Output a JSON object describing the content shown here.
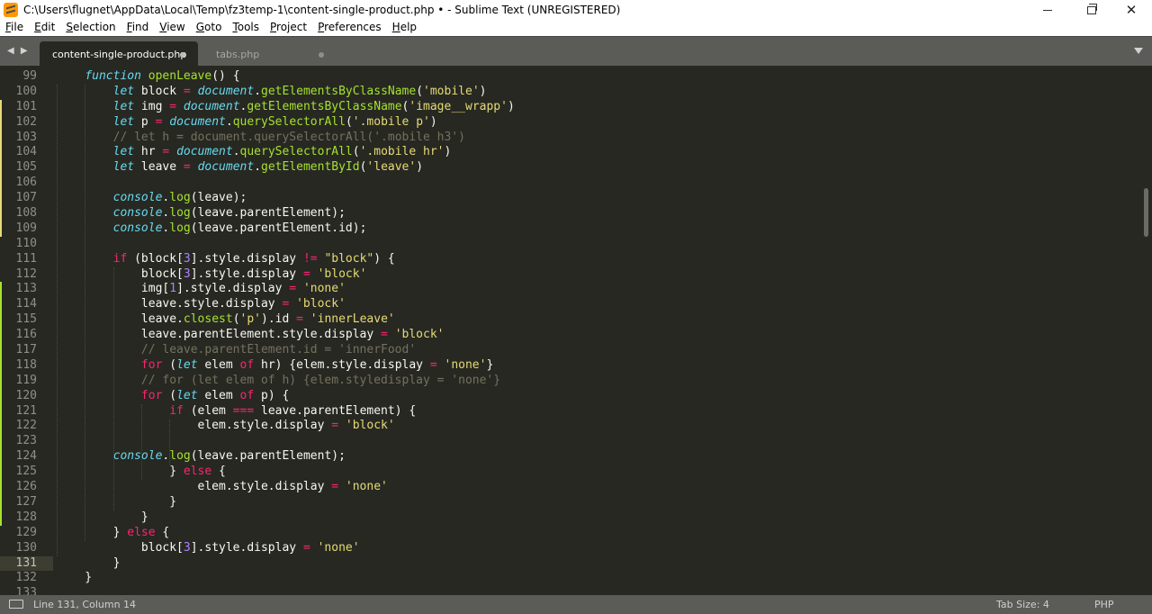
{
  "window": {
    "title": "C:\\Users\\flugnet\\AppData\\Local\\Temp\\fz3temp-1\\content-single-product.php • - Sublime Text (UNREGISTERED)",
    "min_label": "",
    "close_label": "✕"
  },
  "menu": [
    "File",
    "Edit",
    "Selection",
    "Find",
    "View",
    "Goto",
    "Tools",
    "Project",
    "Preferences",
    "Help"
  ],
  "tabs": [
    {
      "label": "content-single-product.php",
      "active": true,
      "modified": true
    },
    {
      "label": "tabs.php",
      "active": false,
      "modified": true
    }
  ],
  "tab_nav": "◀ ▶",
  "editor": {
    "lines": [
      {
        "n": "99",
        "mark": "",
        "code": [
          [
            "    ",
            ""
          ],
          [
            "function",
            "st"
          ],
          [
            " ",
            ""
          ],
          [
            "openLeave",
            "fn"
          ],
          [
            "() {",
            ""
          ]
        ]
      },
      {
        "n": "100",
        "mark": "",
        "code": [
          [
            "        ",
            ""
          ],
          [
            "let",
            "st"
          ],
          [
            " block ",
            ""
          ],
          [
            "=",
            "kw"
          ],
          [
            " ",
            ""
          ],
          [
            "document",
            "sp"
          ],
          [
            ".",
            ""
          ],
          [
            "getElementsByClassName",
            "fn"
          ],
          [
            "(",
            ""
          ],
          [
            "'mobile'",
            "str"
          ],
          [
            ")",
            ""
          ]
        ]
      },
      {
        "n": "101",
        "mark": "mod",
        "code": [
          [
            "        ",
            ""
          ],
          [
            "let",
            "st"
          ],
          [
            " img ",
            ""
          ],
          [
            "=",
            "kw"
          ],
          [
            " ",
            ""
          ],
          [
            "document",
            "sp"
          ],
          [
            ".",
            ""
          ],
          [
            "getElementsByClassName",
            "fn"
          ],
          [
            "(",
            ""
          ],
          [
            "'image__wrapp'",
            "str"
          ],
          [
            ")",
            ""
          ]
        ]
      },
      {
        "n": "102",
        "mark": "mod",
        "code": [
          [
            "        ",
            ""
          ],
          [
            "let",
            "st"
          ],
          [
            " p ",
            ""
          ],
          [
            "=",
            "kw"
          ],
          [
            " ",
            ""
          ],
          [
            "document",
            "sp"
          ],
          [
            ".",
            ""
          ],
          [
            "querySelectorAll",
            "fn"
          ],
          [
            "(",
            ""
          ],
          [
            "'.mobile p'",
            "str"
          ],
          [
            ")",
            ""
          ]
        ]
      },
      {
        "n": "103",
        "mark": "mod",
        "code": [
          [
            "        ",
            ""
          ],
          [
            "// let h = document.querySelectorAll('.mobile h3')",
            "cm"
          ]
        ]
      },
      {
        "n": "104",
        "mark": "mod",
        "code": [
          [
            "        ",
            ""
          ],
          [
            "let",
            "st"
          ],
          [
            " hr ",
            ""
          ],
          [
            "=",
            "kw"
          ],
          [
            " ",
            ""
          ],
          [
            "document",
            "sp"
          ],
          [
            ".",
            ""
          ],
          [
            "querySelectorAll",
            "fn"
          ],
          [
            "(",
            ""
          ],
          [
            "'.mobile hr'",
            "str"
          ],
          [
            ")",
            ""
          ]
        ]
      },
      {
        "n": "105",
        "mark": "mod",
        "code": [
          [
            "        ",
            ""
          ],
          [
            "let",
            "st"
          ],
          [
            " leave ",
            ""
          ],
          [
            "=",
            "kw"
          ],
          [
            " ",
            ""
          ],
          [
            "document",
            "sp"
          ],
          [
            ".",
            ""
          ],
          [
            "getElementById",
            "fn"
          ],
          [
            "(",
            ""
          ],
          [
            "'leave'",
            "str"
          ],
          [
            ")",
            ""
          ]
        ]
      },
      {
        "n": "106",
        "mark": "mod",
        "code": []
      },
      {
        "n": "107",
        "mark": "mod",
        "code": [
          [
            "        ",
            ""
          ],
          [
            "console",
            "sp"
          ],
          [
            ".",
            ""
          ],
          [
            "log",
            "fn"
          ],
          [
            "(leave);",
            ""
          ]
        ]
      },
      {
        "n": "108",
        "mark": "mod",
        "code": [
          [
            "        ",
            ""
          ],
          [
            "console",
            "sp"
          ],
          [
            ".",
            ""
          ],
          [
            "log",
            "fn"
          ],
          [
            "(leave.parentElement);",
            ""
          ]
        ]
      },
      {
        "n": "109",
        "mark": "mod",
        "code": [
          [
            "        ",
            ""
          ],
          [
            "console",
            "sp"
          ],
          [
            ".",
            ""
          ],
          [
            "log",
            "fn"
          ],
          [
            "(leave.parentElement.id);",
            ""
          ]
        ]
      },
      {
        "n": "110",
        "mark": "",
        "code": []
      },
      {
        "n": "111",
        "mark": "",
        "code": [
          [
            "        ",
            ""
          ],
          [
            "if",
            "kw"
          ],
          [
            " (block[",
            ""
          ],
          [
            "3",
            "num"
          ],
          [
            "].style.display ",
            ""
          ],
          [
            "!=",
            "kw"
          ],
          [
            " ",
            ""
          ],
          [
            "\"block\"",
            "str"
          ],
          [
            ") {",
            ""
          ]
        ]
      },
      {
        "n": "112",
        "mark": "",
        "code": [
          [
            "            block[",
            ""
          ],
          [
            "3",
            "num"
          ],
          [
            "].style.display ",
            ""
          ],
          [
            "=",
            "kw"
          ],
          [
            " ",
            ""
          ],
          [
            "'block'",
            "str"
          ]
        ]
      },
      {
        "n": "113",
        "mark": "add",
        "code": [
          [
            "            img[",
            ""
          ],
          [
            "1",
            "num"
          ],
          [
            "].style.display ",
            ""
          ],
          [
            "=",
            "kw"
          ],
          [
            " ",
            ""
          ],
          [
            "'none'",
            "str"
          ]
        ]
      },
      {
        "n": "114",
        "mark": "add",
        "code": [
          [
            "            leave.style.display ",
            ""
          ],
          [
            "=",
            "kw"
          ],
          [
            " ",
            ""
          ],
          [
            "'block'",
            "str"
          ]
        ]
      },
      {
        "n": "115",
        "mark": "add",
        "code": [
          [
            "            leave.",
            ""
          ],
          [
            "closest",
            "fn"
          ],
          [
            "(",
            ""
          ],
          [
            "'p'",
            "str"
          ],
          [
            ").id ",
            ""
          ],
          [
            "=",
            "kw"
          ],
          [
            " ",
            ""
          ],
          [
            "'innerLeave'",
            "str"
          ]
        ]
      },
      {
        "n": "116",
        "mark": "add",
        "code": [
          [
            "            leave.parentElement.style.display ",
            ""
          ],
          [
            "=",
            "kw"
          ],
          [
            " ",
            ""
          ],
          [
            "'block'",
            "str"
          ]
        ]
      },
      {
        "n": "117",
        "mark": "add",
        "code": [
          [
            "            ",
            ""
          ],
          [
            "// leave.parentElement.id = 'innerFood'",
            "cm"
          ]
        ]
      },
      {
        "n": "118",
        "mark": "add",
        "code": [
          [
            "            ",
            ""
          ],
          [
            "for",
            "kw"
          ],
          [
            " (",
            ""
          ],
          [
            "let",
            "st"
          ],
          [
            " elem ",
            ""
          ],
          [
            "of",
            "kw"
          ],
          [
            " hr) {elem.style.display ",
            ""
          ],
          [
            "=",
            "kw"
          ],
          [
            " ",
            ""
          ],
          [
            "'none'",
            "str"
          ],
          [
            "}",
            ""
          ]
        ]
      },
      {
        "n": "119",
        "mark": "add",
        "code": [
          [
            "            ",
            ""
          ],
          [
            "// for (let elem of h) {elem.styledisplay = 'none'}",
            "cm"
          ]
        ]
      },
      {
        "n": "120",
        "mark": "add",
        "code": [
          [
            "            ",
            ""
          ],
          [
            "for",
            "kw"
          ],
          [
            " (",
            ""
          ],
          [
            "let",
            "st"
          ],
          [
            " elem ",
            ""
          ],
          [
            "of",
            "kw"
          ],
          [
            " p) {",
            ""
          ]
        ]
      },
      {
        "n": "121",
        "mark": "add",
        "code": [
          [
            "                ",
            ""
          ],
          [
            "if",
            "kw"
          ],
          [
            " (elem ",
            ""
          ],
          [
            "===",
            "kw"
          ],
          [
            " leave.parentElement) {",
            ""
          ]
        ]
      },
      {
        "n": "122",
        "mark": "add",
        "code": [
          [
            "                    elem.style.display ",
            ""
          ],
          [
            "=",
            "kw"
          ],
          [
            " ",
            ""
          ],
          [
            "'block'",
            "str"
          ]
        ]
      },
      {
        "n": "123",
        "mark": "add",
        "code": []
      },
      {
        "n": "124",
        "mark": "add",
        "code": [
          [
            "        ",
            ""
          ],
          [
            "console",
            "sp"
          ],
          [
            ".",
            ""
          ],
          [
            "log",
            "fn"
          ],
          [
            "(leave.parentElement);",
            ""
          ]
        ]
      },
      {
        "n": "125",
        "mark": "add",
        "code": [
          [
            "                } ",
            ""
          ],
          [
            "else",
            "kw"
          ],
          [
            " {",
            ""
          ]
        ]
      },
      {
        "n": "126",
        "mark": "add",
        "code": [
          [
            "                    elem.style.display ",
            ""
          ],
          [
            "=",
            "kw"
          ],
          [
            " ",
            ""
          ],
          [
            "'none'",
            "str"
          ]
        ]
      },
      {
        "n": "127",
        "mark": "add",
        "code": [
          [
            "                }",
            ""
          ]
        ]
      },
      {
        "n": "128",
        "mark": "add",
        "code": [
          [
            "            }",
            ""
          ]
        ]
      },
      {
        "n": "129",
        "mark": "",
        "code": [
          [
            "        } ",
            ""
          ],
          [
            "else",
            "kw"
          ],
          [
            " {",
            ""
          ]
        ]
      },
      {
        "n": "130",
        "mark": "",
        "code": [
          [
            "            block[",
            ""
          ],
          [
            "3",
            "num"
          ],
          [
            "].style.display ",
            ""
          ],
          [
            "=",
            "kw"
          ],
          [
            " ",
            ""
          ],
          [
            "'none'",
            "str"
          ]
        ]
      },
      {
        "n": "131",
        "mark": "",
        "current": true,
        "code": [
          [
            "        }",
            ""
          ]
        ]
      },
      {
        "n": "132",
        "mark": "",
        "code": [
          [
            "    }",
            ""
          ]
        ]
      },
      {
        "n": "133",
        "mark": "",
        "code": []
      }
    ]
  },
  "status": {
    "position": "Line 131, Column 14",
    "tab_size": "Tab Size: 4",
    "syntax": "PHP"
  },
  "colors": {
    "background": "#272822",
    "keyword": "#f92672",
    "storage": "#66d9ef",
    "function": "#a6e22e",
    "string": "#e6db74",
    "number": "#ae81ff",
    "comment": "#75715e",
    "chrome": "#5b5c57"
  }
}
